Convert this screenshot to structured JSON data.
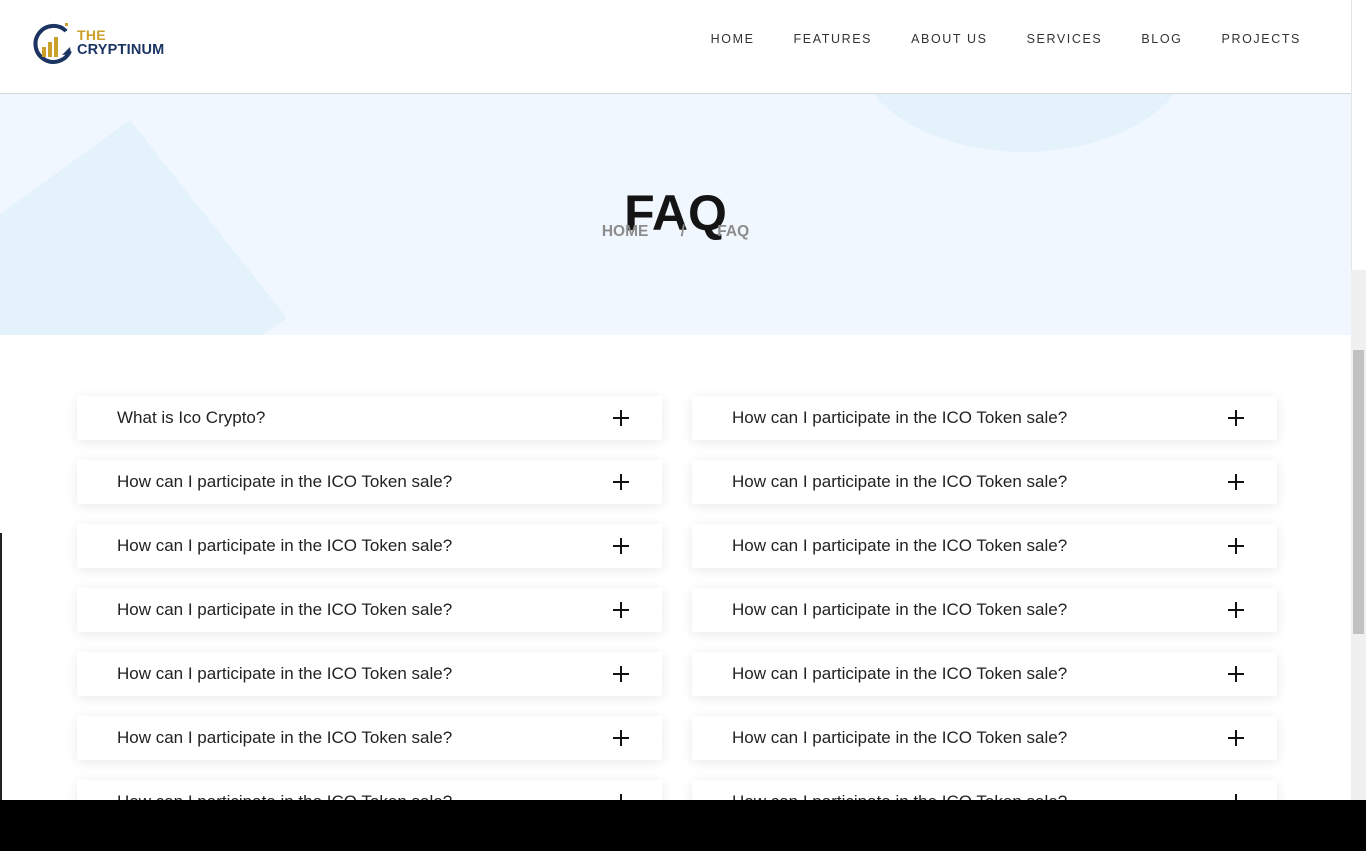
{
  "brand": {
    "logo_line1": "THE",
    "logo_line2": "CRYPTINUM",
    "colors": {
      "gold": "#caa02a",
      "navy": "#1b3462"
    }
  },
  "nav": {
    "items": [
      "HOME",
      "FEATURES",
      "ABOUT US",
      "SERVICES",
      "BLOG",
      "PROJECTS"
    ]
  },
  "hero": {
    "title": "FAQ",
    "breadcrumb": {
      "home": "HOME",
      "separator": "/",
      "current": "FAQ"
    },
    "background": "#f1f7fe"
  },
  "faq": {
    "left": [
      "What is Ico Crypto?",
      "How can I participate in the ICO Token sale?",
      "How can I participate in the ICO Token sale?",
      "How can I participate in the ICO Token sale?",
      "How can I participate in the ICO Token sale?",
      "How can I participate in the ICO Token sale?",
      "How can I participate in the ICO Token sale?"
    ],
    "right": [
      "How can I participate in the ICO Token sale?",
      "How can I participate in the ICO Token sale?",
      "How can I participate in the ICO Token sale?",
      "How can I participate in the ICO Token sale?",
      "How can I participate in the ICO Token sale?",
      "How can I participate in the ICO Token sale?",
      "How can I participate in the ICO Token sale?"
    ],
    "expand_icon": "plus-icon"
  }
}
